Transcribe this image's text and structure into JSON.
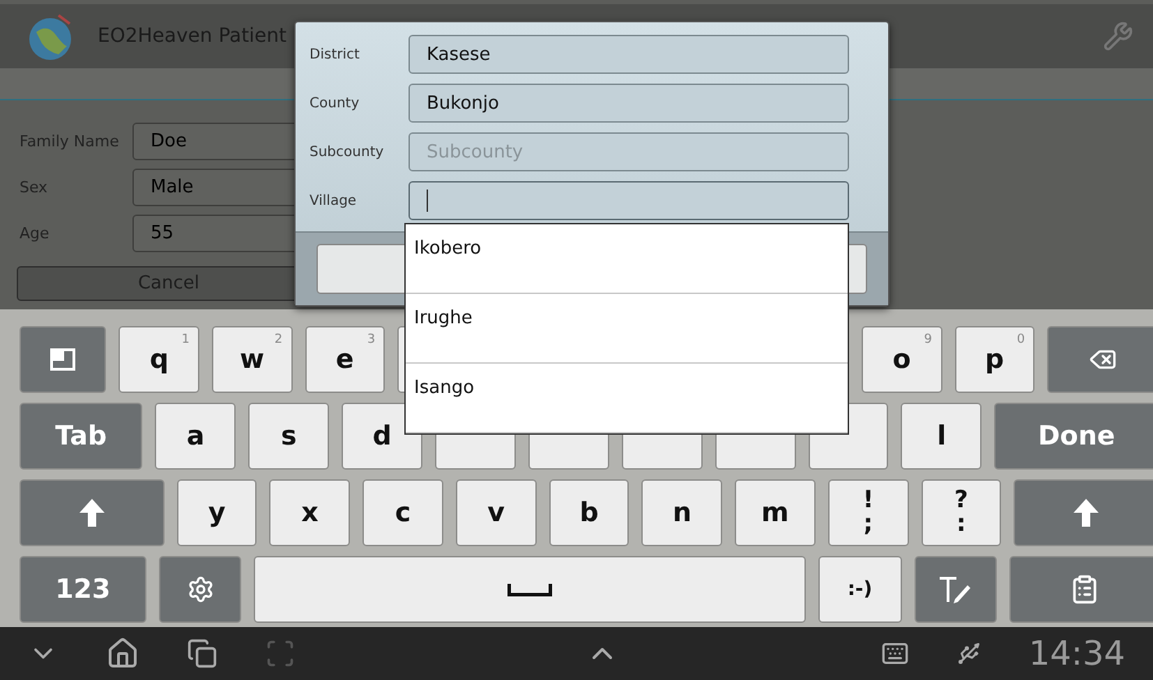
{
  "app_bar": {
    "title": "EO2Heaven Patient"
  },
  "form": {
    "rows": [
      {
        "label": "Family Name",
        "value": "Doe"
      },
      {
        "label": "Sex",
        "value": "Male"
      },
      {
        "label": "Age",
        "value": "55"
      }
    ]
  },
  "cancel_button": "Cancel",
  "dialog": {
    "fields": [
      {
        "label": "District",
        "value": "Kasese",
        "focused": false
      },
      {
        "label": "County",
        "value": "Bukonjo",
        "focused": false
      },
      {
        "label": "Subcounty",
        "placeholder": "Subcounty",
        "focused": false
      },
      {
        "label": "Village",
        "focused": true
      }
    ]
  },
  "suggestions": [
    "Ikobero",
    "Irughe",
    "Isango"
  ],
  "keyboard": {
    "rows": [
      {
        "keys": [
          {
            "kind": "widget"
          },
          {
            "kind": "letter",
            "label": "q",
            "hint": "1"
          },
          {
            "kind": "letter",
            "label": "w",
            "hint": "2"
          },
          {
            "kind": "letter",
            "label": "e",
            "hint": "3"
          },
          {
            "kind": "blank"
          },
          {
            "kind": "blank"
          },
          {
            "kind": "blank"
          },
          {
            "kind": "blank"
          },
          {
            "kind": "blank"
          },
          {
            "kind": "letter",
            "label": "o",
            "hint": "9"
          },
          {
            "kind": "letter",
            "label": "p",
            "hint": "0"
          },
          {
            "kind": "backspace"
          }
        ]
      },
      {
        "keys": [
          {
            "kind": "action",
            "label": "Tab"
          },
          {
            "kind": "letter",
            "label": "a"
          },
          {
            "kind": "letter",
            "label": "s"
          },
          {
            "kind": "letter",
            "label": "d"
          },
          {
            "kind": "blank"
          },
          {
            "kind": "blank"
          },
          {
            "kind": "blank"
          },
          {
            "kind": "blank"
          },
          {
            "kind": "blank"
          },
          {
            "kind": "letter",
            "label": "l"
          },
          {
            "kind": "action",
            "label": "Done"
          }
        ]
      },
      {
        "keys": [
          {
            "kind": "shift"
          },
          {
            "kind": "letter",
            "label": "y"
          },
          {
            "kind": "letter",
            "label": "x"
          },
          {
            "kind": "letter",
            "label": "c"
          },
          {
            "kind": "letter",
            "label": "v"
          },
          {
            "kind": "letter",
            "label": "b"
          },
          {
            "kind": "letter",
            "label": "n"
          },
          {
            "kind": "letter",
            "label": "m"
          },
          {
            "kind": "dual",
            "top": "!",
            "bottom": ";"
          },
          {
            "kind": "dual",
            "top": "?",
            "bottom": ":"
          },
          {
            "kind": "shift"
          }
        ]
      },
      {
        "keys": [
          {
            "kind": "action",
            "label": "123"
          },
          {
            "kind": "settings"
          },
          {
            "kind": "space"
          },
          {
            "kind": "emoticon",
            "label": ":-)"
          },
          {
            "kind": "handwriting"
          },
          {
            "kind": "clipboard"
          }
        ]
      }
    ]
  },
  "status_bar": {
    "time": "14:34"
  }
}
